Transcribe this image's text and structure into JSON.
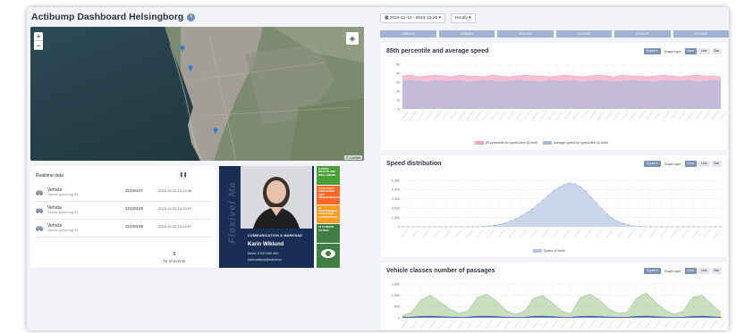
{
  "header": {
    "title": "Actibump Dashboard Helsingborg",
    "info_icon": "info-icon"
  },
  "map": {
    "zoom_in": "+",
    "zoom_out": "−",
    "attribution": "© Leaflet"
  },
  "realtime": {
    "title": "Realtime data",
    "pause_icon": "pause-icon",
    "rows": [
      {
        "type": "Vehicle",
        "sub": "Vehicle speed avg 35",
        "id": "22100107",
        "time": "2024-12-20 14:13:36"
      },
      {
        "type": "Vehicle",
        "sub": "Vehicle speed avg 30",
        "id": "22100108",
        "time": "2024-12-20 14:13:27"
      },
      {
        "type": "Vehicle",
        "sub": "Vehicle speed avg 30",
        "id": "22100108",
        "time": "2024-12-20 14:13:27"
      }
    ],
    "event_count": "8",
    "event_label": "Nr of events"
  },
  "person": {
    "vertical_text": "Flexivel Me",
    "role": "COMMUNICATION & MARKNAD",
    "name": "Karin Wiklund",
    "phone": "Mobil: 0700 900 405",
    "email": "karin.wiklund@edeva.se"
  },
  "sdg": [
    {
      "label": "3 GOOD HEALTH AND WELL-BEING",
      "color": "#4c9f38"
    },
    {
      "label": "9 INDUSTRY INNOVATION AND INFRASTRUCTURE",
      "color": "#fd6925"
    },
    {
      "label": "11 SUSTAINABLE CITIES AND COMMUNITIES",
      "color": "#fd9d24"
    },
    {
      "label": "13 CLIMATE ACTION",
      "color": "#3f7e44"
    },
    {
      "label": "",
      "color": "#3f7e44"
    }
  ],
  "toolbar": {
    "date_range": "2024-12-14 - 2024-12-20",
    "interval": "Hourly"
  },
  "date_tabs": [
    "19080023",
    "19080024",
    "22100105",
    "22100106",
    "22100107",
    "22100108"
  ],
  "graph_controls": {
    "export": "Export",
    "graph_type": "Graph type",
    "types": [
      "Area",
      "Line",
      "Bar"
    ],
    "active": "Area"
  },
  "charts": {
    "speed": {
      "title": "85th percentile and average speed",
      "legend": [
        "85 percentile for speed limit 40 km/h",
        "Average speed for speed limit 40 km/h"
      ],
      "colors": [
        "#f0a3c2",
        "#aeb9d8"
      ]
    },
    "distribution": {
      "title": "Speed distribution",
      "legend": [
        "Speed 40 km/h"
      ],
      "colors": [
        "#b7c4e2"
      ]
    },
    "classes": {
      "title": "Vehicle classes number of passages",
      "colors": [
        "#9cc48b",
        "#4763b8"
      ]
    }
  },
  "chart_data": [
    {
      "type": "area",
      "title": "85th percentile and average speed",
      "ylim": [
        0,
        50
      ],
      "yticks": [
        0,
        10,
        20,
        30,
        40,
        50
      ],
      "series": [
        {
          "name": "85 percentile for speed limit 40 km/h",
          "values": [
            37,
            38,
            36,
            37,
            38,
            37,
            36,
            38,
            37,
            37,
            36,
            38,
            37,
            36,
            37,
            38,
            37,
            37,
            36,
            37,
            38,
            37,
            36,
            37,
            38,
            37,
            36,
            38,
            37,
            37,
            36,
            37,
            38,
            37,
            36,
            37,
            38,
            37,
            37,
            36
          ]
        },
        {
          "name": "Average speed for speed limit 40 km/h",
          "values": [
            31,
            32,
            31,
            30,
            32,
            31,
            31,
            32,
            30,
            31,
            32,
            31,
            30,
            31,
            32,
            31,
            31,
            30,
            32,
            31,
            31,
            32,
            30,
            31,
            32,
            31,
            30,
            31,
            32,
            31,
            31,
            30,
            32,
            31,
            31,
            32,
            30,
            31,
            32,
            31
          ]
        }
      ]
    },
    {
      "type": "area",
      "title": "Speed distribution",
      "ylim": [
        0,
        5000
      ],
      "yticks": [
        0,
        1000,
        2000,
        3000,
        4000,
        5000
      ],
      "series": [
        {
          "name": "Speed 40 km/h",
          "values": [
            0,
            0,
            0,
            0,
            0,
            0,
            0,
            0,
            0,
            0,
            0,
            0,
            5,
            10,
            20,
            40,
            80,
            150,
            250,
            400,
            600,
            850,
            1150,
            1500,
            1900,
            2350,
            2850,
            3350,
            3850,
            4250,
            4550,
            4700,
            4600,
            4300,
            3800,
            3200,
            2550,
            1900,
            1350,
            900,
            560,
            330,
            180,
            90,
            45,
            20,
            10,
            5,
            0,
            0,
            0,
            0,
            0,
            0,
            0,
            0,
            0,
            0,
            0,
            0
          ]
        }
      ]
    },
    {
      "type": "area",
      "title": "Vehicle classes number of passages",
      "ylim": [
        0,
        1500
      ],
      "yticks": [
        0,
        500,
        1000,
        1500
      ],
      "series": [
        {
          "values": [
            100,
            250,
            800,
            1000,
            700,
            400,
            200,
            300,
            900,
            1050,
            750,
            350,
            150,
            280,
            850,
            1000,
            650,
            300,
            180,
            900,
            1050,
            800,
            400,
            200,
            250,
            850,
            1100,
            700,
            350,
            150,
            300,
            900,
            1000,
            600,
            250
          ]
        },
        {
          "values": [
            20,
            30,
            60,
            70,
            50,
            30,
            20,
            25,
            65,
            70,
            55,
            25,
            15,
            20,
            60,
            70,
            50,
            20,
            15,
            60,
            70,
            55,
            30,
            15,
            20,
            60,
            75,
            50,
            25,
            15,
            20,
            60,
            70,
            45,
            20
          ]
        }
      ]
    }
  ]
}
